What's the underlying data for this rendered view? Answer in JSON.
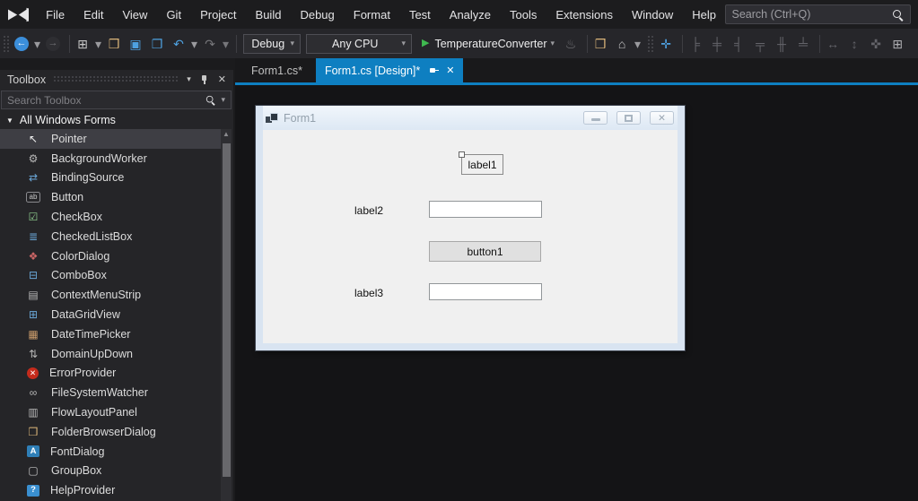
{
  "colors": {
    "accent_blue": "#0e7fc1",
    "run_green": "#3fb950",
    "selection_gray": "#3e3e44",
    "panel_bg": "#252528",
    "editor_bg": "#141416",
    "form_frame": "#d9e4f1",
    "form_client": "#f0f0f0"
  },
  "menu_bar": {
    "logo": "visual-studio-logo",
    "items": [
      "File",
      "Edit",
      "View",
      "Git",
      "Project",
      "Build",
      "Debug",
      "Format",
      "Test",
      "Analyze",
      "Tools",
      "Extensions",
      "Window",
      "Help"
    ],
    "search_placeholder": "Search (Ctrl+Q)"
  },
  "toolbar": {
    "items": [
      {
        "kind": "grip",
        "name": "toolbar-drag-grip"
      },
      {
        "kind": "icon",
        "name": "navigate-back-button",
        "glyph": "←",
        "color": "#ffffff",
        "bg": "#3b8eda",
        "shape": "round"
      },
      {
        "kind": "caret",
        "name": "navigate-back-caret",
        "glyph": "▾",
        "color": "#9a9a9e"
      },
      {
        "kind": "icon",
        "name": "navigate-forward-button",
        "glyph": "→",
        "color": "#76767a",
        "bg": "#2e2e32",
        "shape": "round"
      },
      {
        "kind": "sep",
        "name": "toolbar-separator"
      },
      {
        "kind": "icon",
        "name": "new-project-button",
        "glyph": "⊞",
        "color": "#c8c8c8"
      },
      {
        "kind": "caret",
        "name": "new-project-caret",
        "glyph": "▾",
        "color": "#9a9a9e"
      },
      {
        "kind": "icon",
        "name": "open-file-button",
        "glyph": "❒",
        "color": "#dcb67a"
      },
      {
        "kind": "icon",
        "name": "save-button",
        "glyph": "▣",
        "color": "#4ea1e0"
      },
      {
        "kind": "icon",
        "name": "save-all-button",
        "glyph": "❐",
        "color": "#4ea1e0"
      },
      {
        "kind": "icon",
        "name": "undo-button",
        "glyph": "↶",
        "color": "#4ea1e0"
      },
      {
        "kind": "caret",
        "name": "undo-caret",
        "glyph": "▾",
        "color": "#9a9a9e"
      },
      {
        "kind": "icon",
        "name": "redo-button",
        "glyph": "↷",
        "color": "#76767a"
      },
      {
        "kind": "caret",
        "name": "redo-caret",
        "glyph": "▾",
        "color": "#76767a"
      },
      {
        "kind": "sep",
        "name": "toolbar-separator"
      },
      {
        "kind": "combo",
        "name": "debug-configuration-combo",
        "label": "Debug",
        "caret": "▾"
      },
      {
        "kind": "combo",
        "name": "platform-combo",
        "label": "Any CPU",
        "caret": "▾"
      },
      {
        "kind": "run",
        "name": "start-debugging-button",
        "glyph": "▶",
        "label": "TemperatureConverter",
        "caret": "▾",
        "color": "#3fb950"
      },
      {
        "kind": "icon",
        "name": "hot-reload-button",
        "glyph": "♨",
        "color": "#76767a"
      },
      {
        "kind": "sep",
        "name": "toolbar-separator"
      },
      {
        "kind": "icon",
        "name": "folder-search-button",
        "glyph": "❒",
        "color": "#dcb67a"
      },
      {
        "kind": "icon",
        "name": "preview-window-button",
        "glyph": "⌂",
        "color": "#c8c8c8"
      },
      {
        "kind": "caret",
        "name": "preview-window-caret",
        "glyph": "▾",
        "color": "#9a9a9e"
      },
      {
        "kind": "grip",
        "name": "toolbar-drag-grip"
      },
      {
        "kind": "icon",
        "name": "snap-to-grid-button",
        "glyph": "✛",
        "color": "#4ea1e0"
      },
      {
        "kind": "sep",
        "name": "toolbar-separator"
      },
      {
        "kind": "icon",
        "name": "align-lefts-button",
        "glyph": "╞",
        "color": "#64646a"
      },
      {
        "kind": "icon",
        "name": "align-centers-button",
        "glyph": "╪",
        "color": "#64646a"
      },
      {
        "kind": "icon",
        "name": "align-rights-button",
        "glyph": "╡",
        "color": "#64646a"
      },
      {
        "kind": "icon",
        "name": "align-tops-button",
        "glyph": "╤",
        "color": "#64646a"
      },
      {
        "kind": "icon",
        "name": "align-middles-button",
        "glyph": "╫",
        "color": "#64646a"
      },
      {
        "kind": "icon",
        "name": "align-bottoms-button",
        "glyph": "╧",
        "color": "#64646a"
      },
      {
        "kind": "sep",
        "name": "toolbar-separator"
      },
      {
        "kind": "icon",
        "name": "make-same-width-button",
        "glyph": "↔",
        "color": "#64646a"
      },
      {
        "kind": "icon",
        "name": "make-same-height-button",
        "glyph": "↕",
        "color": "#64646a"
      },
      {
        "kind": "icon",
        "name": "make-same-size-button",
        "glyph": "✜",
        "color": "#64646a"
      },
      {
        "kind": "icon",
        "name": "tab-order-button",
        "glyph": "⊞",
        "color": "#aeaeb2"
      }
    ]
  },
  "tab_strip": {
    "tabs": [
      {
        "label": "Form1.cs*",
        "active": false
      },
      {
        "label": "Form1.cs [Design]*",
        "active": true
      }
    ]
  },
  "toolbox": {
    "title": "Toolbox",
    "search_placeholder": "Search Toolbox",
    "group_header": "All Windows Forms",
    "items": [
      {
        "label": "Pointer",
        "name": "toolbox-item-pointer",
        "glyph": "↖",
        "color": "#f0f0f0",
        "shape": "plain",
        "selected": true
      },
      {
        "label": "BackgroundWorker",
        "name": "toolbox-item-backgroundworker",
        "glyph": "⚙",
        "color": "#b8b8b8",
        "shape": "plain",
        "selected": false
      },
      {
        "label": "BindingSource",
        "name": "toolbox-item-bindingsource",
        "glyph": "⇄",
        "color": "#6aa7d8",
        "shape": "plain",
        "selected": false
      },
      {
        "label": "Button",
        "name": "toolbox-item-button",
        "glyph": "ab",
        "color": "#c8c8c8",
        "shape": "box",
        "selected": false
      },
      {
        "label": "CheckBox",
        "name": "toolbox-item-checkbox",
        "glyph": "☑",
        "color": "#8fce8f",
        "shape": "plain",
        "selected": false
      },
      {
        "label": "CheckedListBox",
        "name": "toolbox-item-checkedlistbox",
        "glyph": "≣",
        "color": "#6aa7d8",
        "shape": "plain",
        "selected": false
      },
      {
        "label": "ColorDialog",
        "name": "toolbox-item-colordialog",
        "glyph": "❖",
        "color": "#cc6666",
        "shape": "plain",
        "selected": false
      },
      {
        "label": "ComboBox",
        "name": "toolbox-item-combobox",
        "glyph": "⊟",
        "color": "#6aa7d8",
        "shape": "plain",
        "selected": false
      },
      {
        "label": "ContextMenuStrip",
        "name": "toolbox-item-contextmenustrip",
        "glyph": "▤",
        "color": "#b8b8b8",
        "shape": "plain",
        "selected": false
      },
      {
        "label": "DataGridView",
        "name": "toolbox-item-datagridview",
        "glyph": "⊞",
        "color": "#6aa7d8",
        "shape": "plain",
        "selected": false
      },
      {
        "label": "DateTimePicker",
        "name": "toolbox-item-datetimepicker",
        "glyph": "▦",
        "color": "#c89a6a",
        "shape": "plain",
        "selected": false
      },
      {
        "label": "DomainUpDown",
        "name": "toolbox-item-domainupdown",
        "glyph": "⇅",
        "color": "#b8b8b8",
        "shape": "plain",
        "selected": false
      },
      {
        "label": "ErrorProvider",
        "name": "toolbox-item-errorprovider",
        "glyph": "✕",
        "color": "#ffffff",
        "bg": "#c42b1c",
        "shape": "round",
        "selected": false
      },
      {
        "label": "FileSystemWatcher",
        "name": "toolbox-item-filesystemwatcher",
        "glyph": "∞",
        "color": "#b8b8b8",
        "shape": "plain",
        "selected": false
      },
      {
        "label": "FlowLayoutPanel",
        "name": "toolbox-item-flowlayoutpanel",
        "glyph": "▥",
        "color": "#b8b8b8",
        "shape": "plain",
        "selected": false
      },
      {
        "label": "FolderBrowserDialog",
        "name": "toolbox-item-folderbrowserdialog",
        "glyph": "❒",
        "color": "#dcb67a",
        "shape": "plain",
        "selected": false
      },
      {
        "label": "FontDialog",
        "name": "toolbox-item-fontdialog",
        "glyph": "A",
        "color": "#ffffff",
        "bg": "#2f7fb7",
        "shape": "badge",
        "selected": false
      },
      {
        "label": "GroupBox",
        "name": "toolbox-item-groupbox",
        "glyph": "▢",
        "color": "#c8c8c8",
        "shape": "plain",
        "selected": false
      },
      {
        "label": "HelpProvider",
        "name": "toolbox-item-helpprovider",
        "glyph": "?",
        "color": "#ffffff",
        "bg": "#3a8fd0",
        "shape": "badge",
        "selected": false
      }
    ]
  },
  "designer": {
    "form_title": "Form1",
    "caption_buttons": [
      "minimize",
      "maximize",
      "close"
    ],
    "controls": {
      "label1": "label1",
      "label2": "label2",
      "textbox1_value": "",
      "button1": "button1",
      "label3": "label3",
      "textbox2_value": ""
    }
  }
}
